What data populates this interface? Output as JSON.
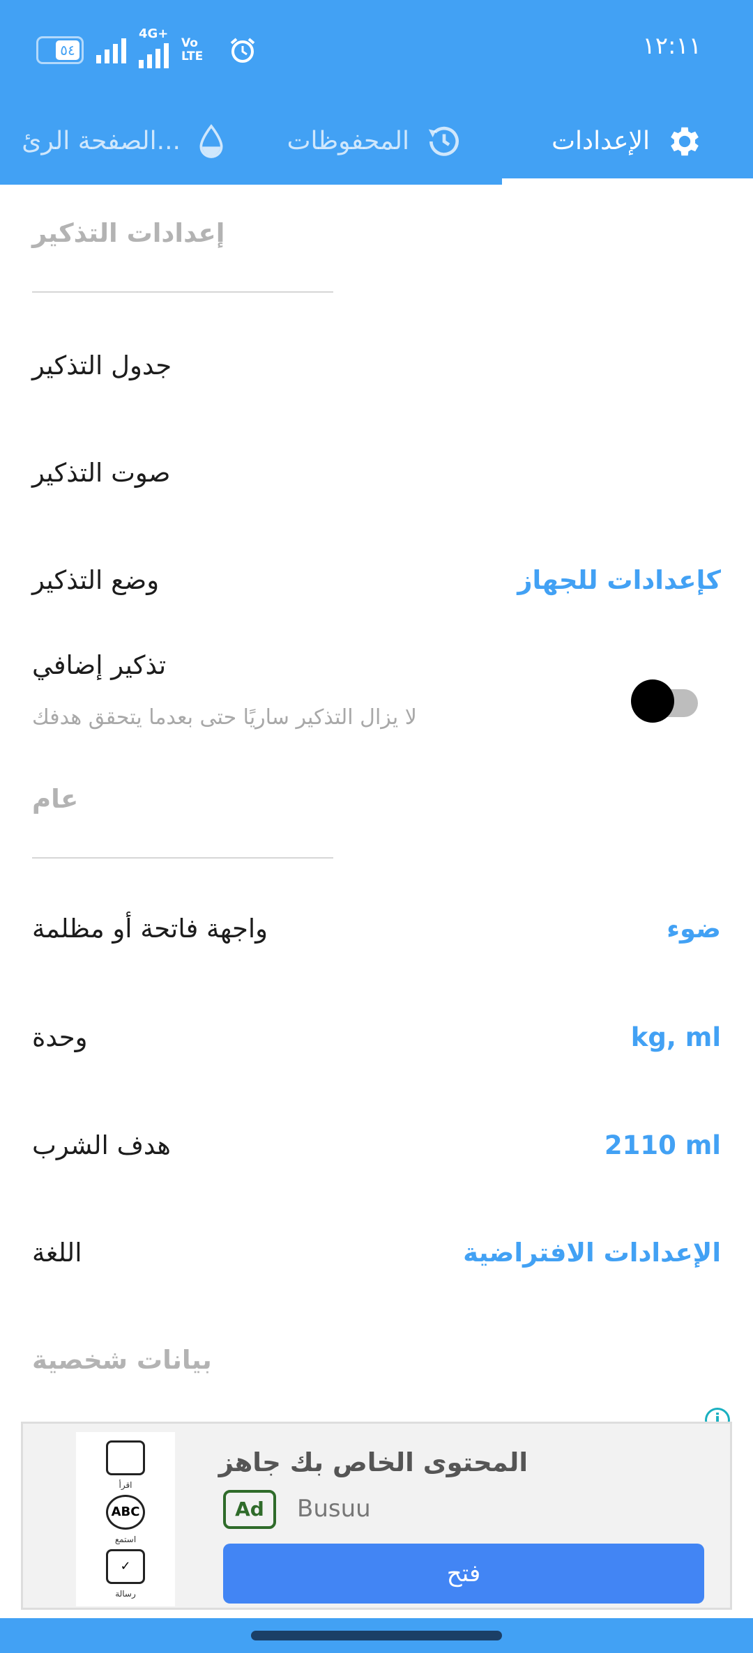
{
  "status_bar": {
    "time": "١٢:١١",
    "battery": "٥٤",
    "network_4g": "4G+",
    "volte": "Vo LTE",
    "icons": [
      "battery-icon",
      "signal-icon",
      "signal-4g-icon",
      "volte-icon",
      "alarm-icon"
    ]
  },
  "tabs": [
    {
      "label": "الإعدادات",
      "icon": "gear-icon",
      "active": true
    },
    {
      "label": "المحفوظات",
      "icon": "history-icon",
      "active": false
    },
    {
      "label": "الصفحة الرئ...",
      "icon": "water-drop-icon",
      "active": false
    }
  ],
  "sections": {
    "reminder": {
      "title": "إعدادات التذكير",
      "schedule_label": "جدول التذكير",
      "sound_label": "صوت التذكير",
      "mode_label": "وضع التذكير",
      "mode_value": "كإعدادات للجهاز",
      "extra_label": "تذكير إضافي",
      "extra_sub": "لا يزال التذكير ساريًا حتى بعدما يتحقق هدفك",
      "extra_enabled": false
    },
    "general": {
      "title": "عام",
      "theme_label": "واجهة فاتحة أو مظلمة",
      "theme_value": "ضوء",
      "unit_label": "وحدة",
      "unit_value": "kg, ml",
      "goal_label": "هدف الشرب",
      "goal_value": "2110 ml",
      "language_label": "اللغة",
      "language_value": "الإعدادات الافتراضية"
    },
    "personal": {
      "title": "بيانات شخصية"
    }
  },
  "ad": {
    "title": "المحتوى الخاص بك جاهز",
    "badge": "Ad",
    "advertiser": "Busuu",
    "button": "فتح",
    "info_icon": "i",
    "image_captions": [
      "اقرأ",
      "استمع",
      "رسالة"
    ],
    "image_icon_text": [
      "",
      "ABC",
      "✓"
    ],
    "colors": {
      "button": "#4285f4",
      "badge": "#2f6b2a"
    }
  },
  "colors": {
    "accent": "#42a1f4",
    "header": "#42a1f4"
  }
}
